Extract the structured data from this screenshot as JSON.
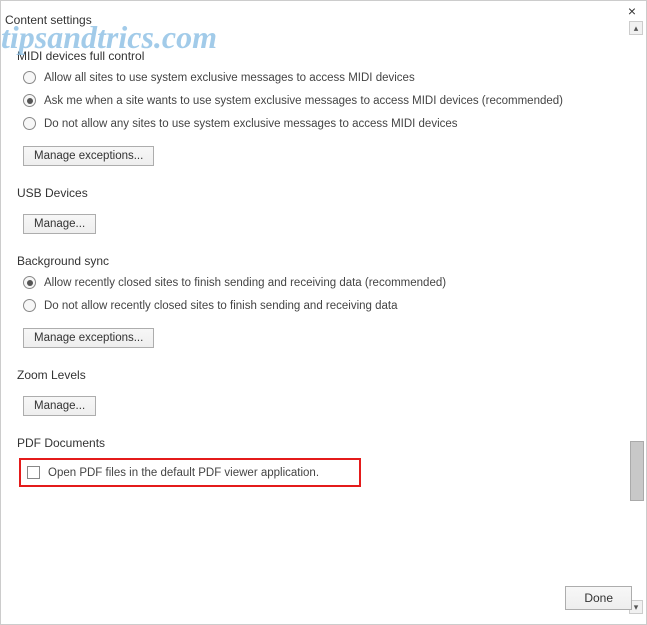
{
  "window": {
    "title": "Content settings",
    "close": "×",
    "done": "Done"
  },
  "watermark": "tipsandtrics.com",
  "sections": {
    "midi": {
      "heading": "MIDI devices full control",
      "opt1": "Allow all sites to use system exclusive messages to access MIDI devices",
      "opt2": "Ask me when a site wants to use system exclusive messages to access MIDI devices (recommended)",
      "opt3": "Do not allow any sites to use system exclusive messages to access MIDI devices",
      "selected": 2,
      "button": "Manage exceptions..."
    },
    "usb": {
      "heading": "USB Devices",
      "button": "Manage..."
    },
    "bgsync": {
      "heading": "Background sync",
      "opt1": "Allow recently closed sites to finish sending and receiving data (recommended)",
      "opt2": "Do not allow recently closed sites to finish sending and receiving data",
      "selected": 1,
      "button": "Manage exceptions..."
    },
    "zoom": {
      "heading": "Zoom Levels",
      "button": "Manage..."
    },
    "pdf": {
      "heading": "PDF Documents",
      "checkbox_label": "Open PDF files in the default PDF viewer application.",
      "checked": false
    }
  }
}
